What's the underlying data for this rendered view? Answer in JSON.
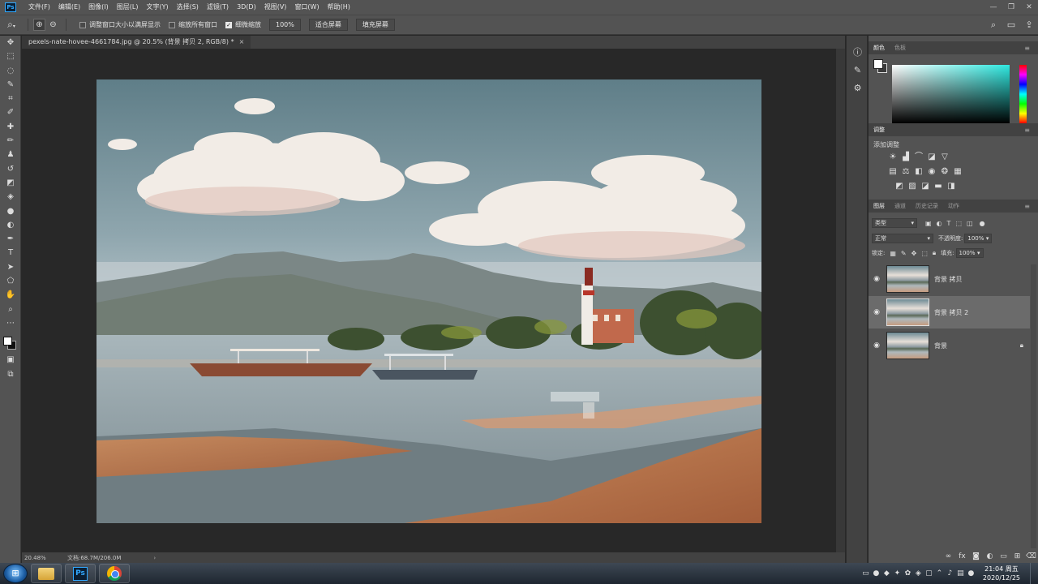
{
  "menubar": {
    "logo": "Ps",
    "items": [
      "文件(F)",
      "编辑(E)",
      "图像(I)",
      "图层(L)",
      "文字(Y)",
      "选择(S)",
      "滤镜(T)",
      "3D(D)",
      "视图(V)",
      "窗口(W)",
      "帮助(H)"
    ],
    "window_controls": [
      "—",
      "❐",
      "✕"
    ]
  },
  "optionsbar": {
    "tool_icon": "zoom-icon",
    "resize_windows_label": "调整窗口大小以满屏显示",
    "resize_windows_checked": false,
    "zoom_all_label": "缩放所有窗口",
    "zoom_all_checked": false,
    "scrubby_label": "细微缩放",
    "scrubby_checked": true,
    "zoom_value": "100%",
    "fit_screen_label": "适合屏幕",
    "fill_screen_label": "填充屏幕"
  },
  "document": {
    "tab_title": "pexels-nate-hovee-4661784.jpg @ 20.5% (背景 拷贝 2, RGB/8) *",
    "close": "×"
  },
  "statusbar": {
    "zoom": "20.48%",
    "doc_size": "文档:68.7M/206.0M",
    "arrow": "›"
  },
  "color_panel": {
    "tabs": [
      "颜色",
      "色板"
    ],
    "fg_color": "#ffffff",
    "bg_color": "#3a3a3a"
  },
  "adjustments_panel": {
    "title": "调整",
    "add_label": "添加调整"
  },
  "layers_panel": {
    "tabs": [
      "图层",
      "通道",
      "历史记录",
      "动作"
    ],
    "filter_kind": "类型",
    "blend_mode": "正常",
    "opacity_label": "不透明度:",
    "opacity_value": "100%",
    "lock_label": "锁定:",
    "fill_label": "填充:",
    "fill_value": "100%",
    "layers": [
      {
        "name": "背景 拷贝",
        "selected": false,
        "locked": false
      },
      {
        "name": "背景 拷贝 2",
        "selected": true,
        "locked": false
      },
      {
        "name": "背景",
        "selected": false,
        "locked": true
      }
    ],
    "bottom_icons": [
      "link-icon",
      "fx-icon",
      "mask-icon",
      "adjustment-icon",
      "group-icon",
      "new-layer-icon",
      "trash-icon"
    ]
  },
  "taskbar": {
    "time": "21:04 周五",
    "date": "2020/12/25",
    "apps": [
      "explorer",
      "photoshop",
      "chrome"
    ]
  },
  "colors": {
    "ps_accent": "#31a8ff",
    "panel_bg": "#535353",
    "canvas_bg": "#282828"
  }
}
